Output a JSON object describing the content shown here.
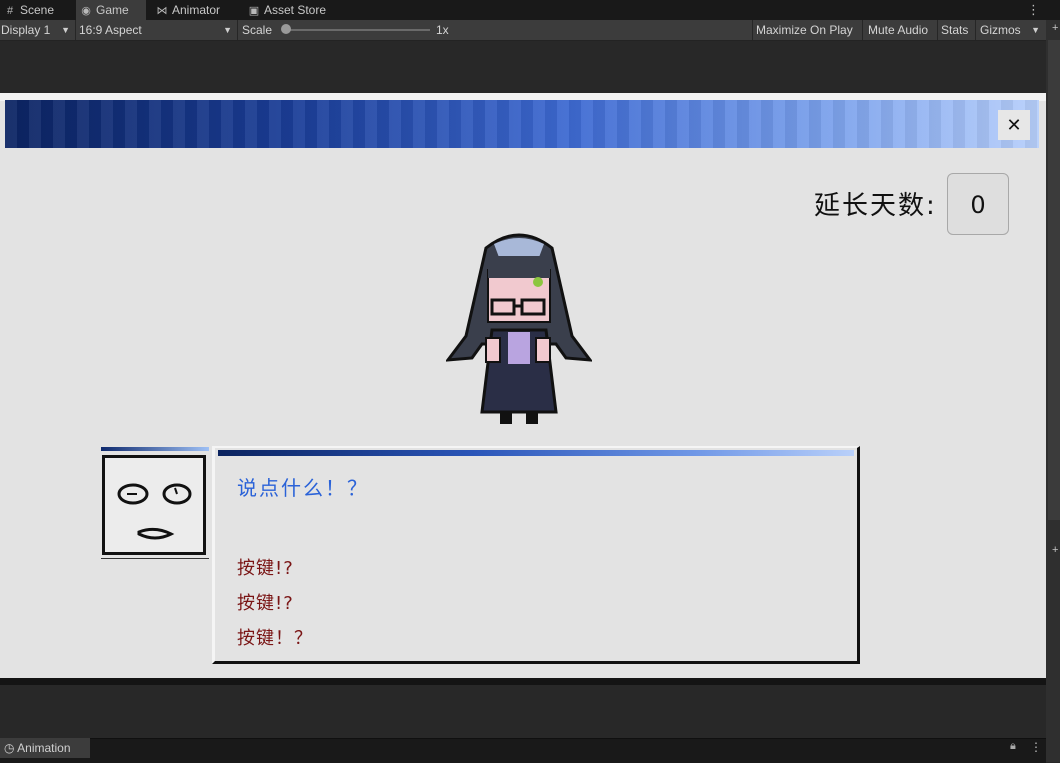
{
  "tabs": [
    {
      "label": "Scene",
      "icon": "grid-icon"
    },
    {
      "label": "Game",
      "icon": "gamepad-icon"
    },
    {
      "label": "Animator",
      "icon": "animator-icon"
    },
    {
      "label": "Asset Store",
      "icon": "store-icon"
    }
  ],
  "toolbar": {
    "display": "Display 1",
    "aspect": "16:9 Aspect",
    "scale_label": "Scale",
    "scale_value": "1x",
    "scale_fraction": 0.0,
    "maximize": "Maximize On Play",
    "mute": "Mute Audio",
    "stats": "Stats",
    "gizmos": "Gizmos"
  },
  "game": {
    "days_label": "延长天数:",
    "days_value": "0",
    "close_icon": "close-icon",
    "dialog": {
      "prompt": "说点什么！？",
      "options": [
        "按键!?",
        "按键!?",
        "按键！？"
      ]
    }
  },
  "bottom": {
    "animation_tab": "Animation"
  },
  "colors": {
    "editor_bg": "#282828",
    "game_bg": "#e3e3e3",
    "prompt_text": "#2a62d8",
    "option_text": "#7a1515",
    "banner_dark": "#0c2463",
    "banner_light": "#b7cffb"
  }
}
